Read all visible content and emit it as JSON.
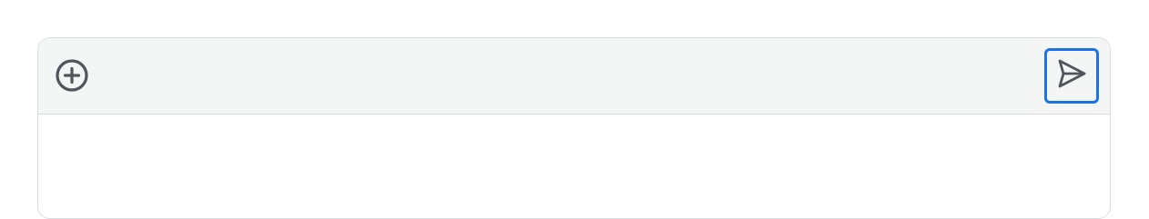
{
  "composer": {
    "attach_icon": "plus-circle-icon",
    "send_icon": "send-icon",
    "send_focused": true,
    "message_text": ""
  },
  "colors": {
    "toolbar_bg": "#f4f6f6",
    "icon": "#50555b",
    "focus_ring": "#1a73e8",
    "border": "#d9dcdf"
  }
}
